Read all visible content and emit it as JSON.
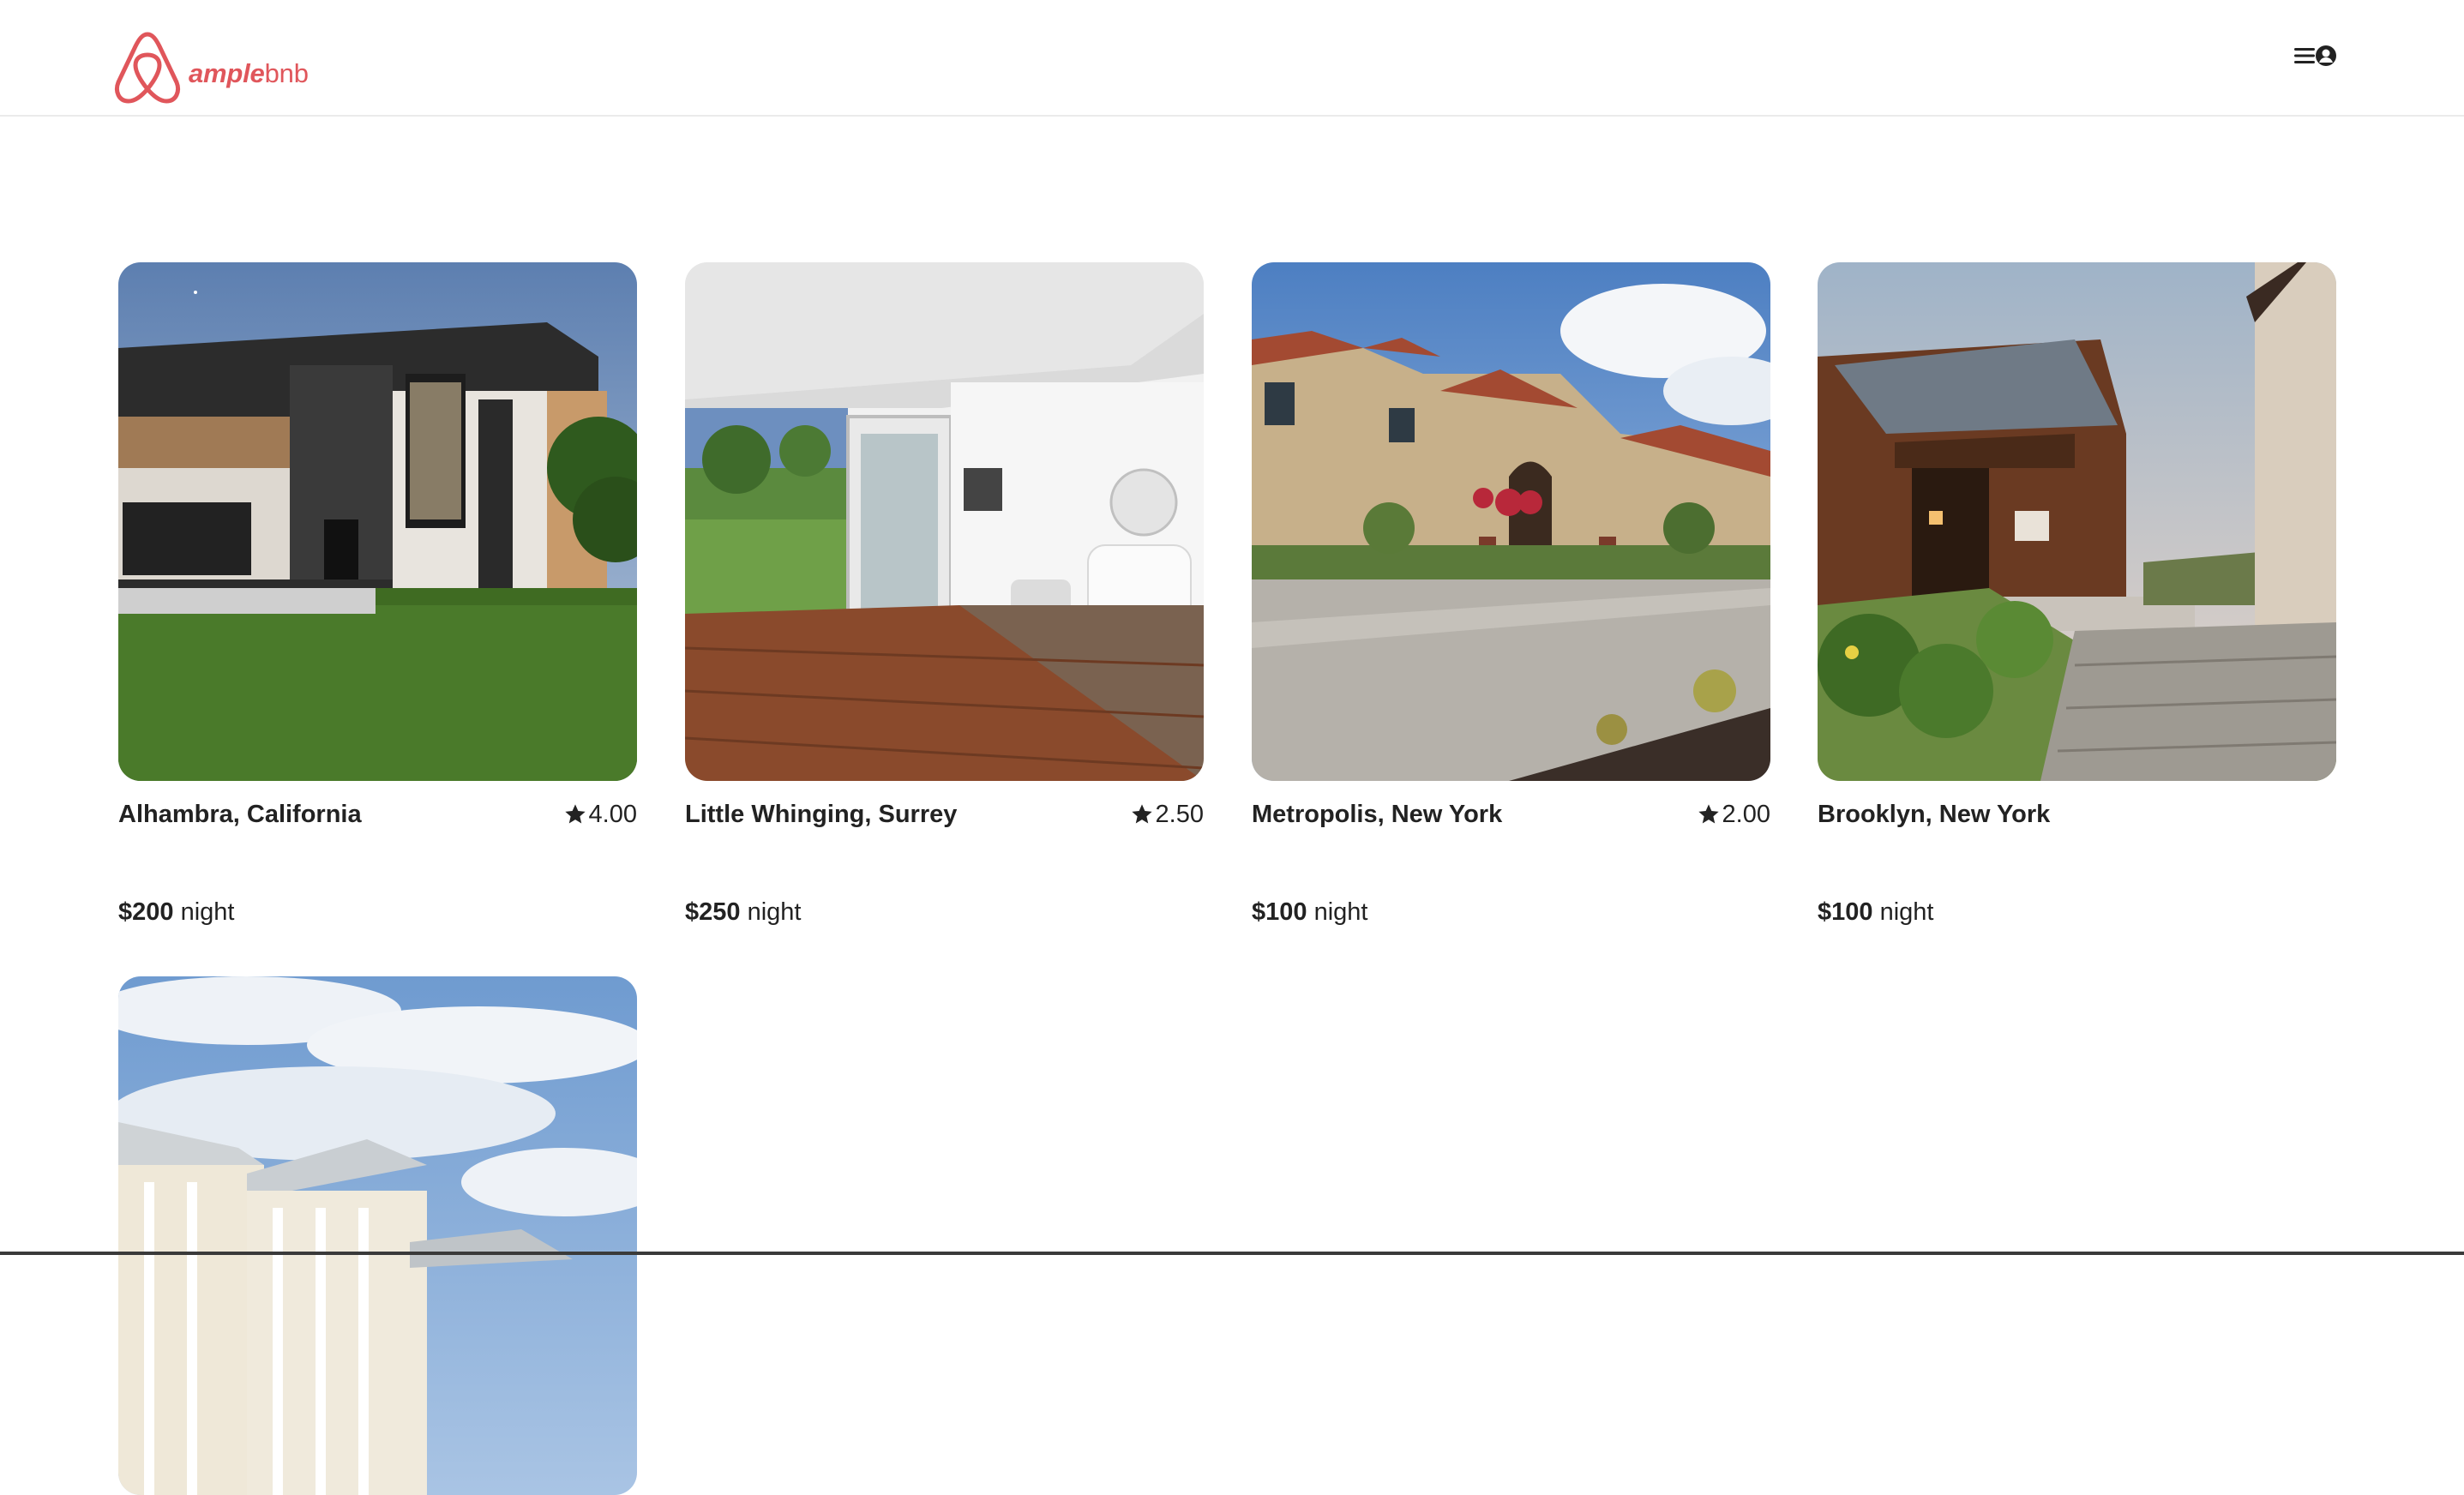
{
  "app": {
    "brand_bold": "ample",
    "brand_rest": "bnb",
    "brand_color": "#e0565b"
  },
  "header": {
    "menu_icon": "hamburger-icon",
    "profile_icon": "user-circle-icon"
  },
  "listings": [
    {
      "location": "Alhambra, California",
      "rating": "4.00",
      "price": "$200",
      "price_unit": "night",
      "image": "modern-two-story-house"
    },
    {
      "location": "Little Whinging, Surrey",
      "rating": "2.50",
      "price": "$250",
      "price_unit": "night",
      "image": "sunroom-with-deck"
    },
    {
      "location": "Metropolis, New York",
      "rating": "2.00",
      "price": "$100",
      "price_unit": "night",
      "image": "stone-mansion"
    },
    {
      "location": "Brooklyn, New York",
      "rating": "",
      "price": "$100",
      "price_unit": "night",
      "image": "wooden-cabin-courtyard"
    },
    {
      "location": "",
      "rating": "",
      "price": "",
      "price_unit": "",
      "image": "beach-house-sky"
    }
  ]
}
